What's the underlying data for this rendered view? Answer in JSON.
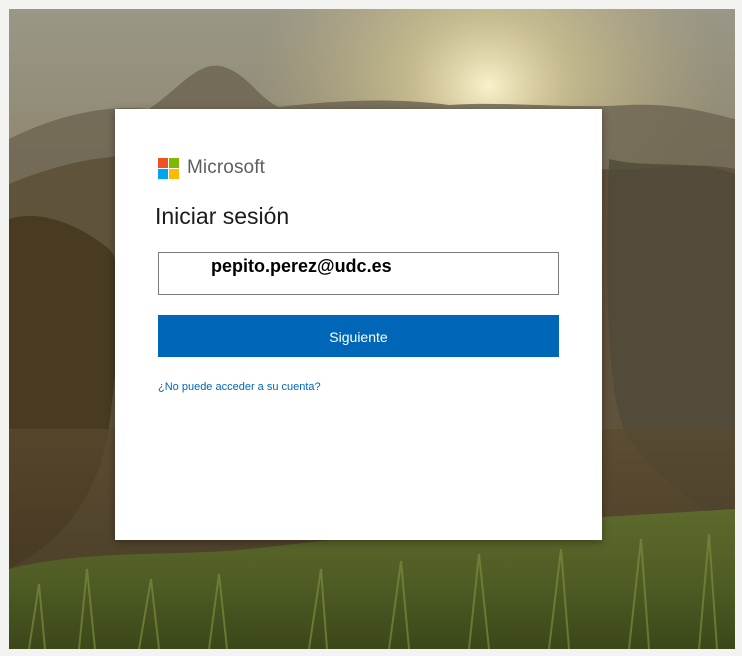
{
  "login": {
    "brand_name": "Microsoft",
    "title": "Iniciar sesión",
    "email_value": "pepito.perez@udc.es",
    "next_label": "Siguiente",
    "help_link": "¿No puede acceder a su cuenta?"
  },
  "colors": {
    "accent": "#0067b8",
    "logo_red": "#f25022",
    "logo_green": "#7fba00",
    "logo_blue": "#00a4ef",
    "logo_yellow": "#ffb900"
  },
  "icons": {
    "logo": "microsoft-logo-icon"
  }
}
